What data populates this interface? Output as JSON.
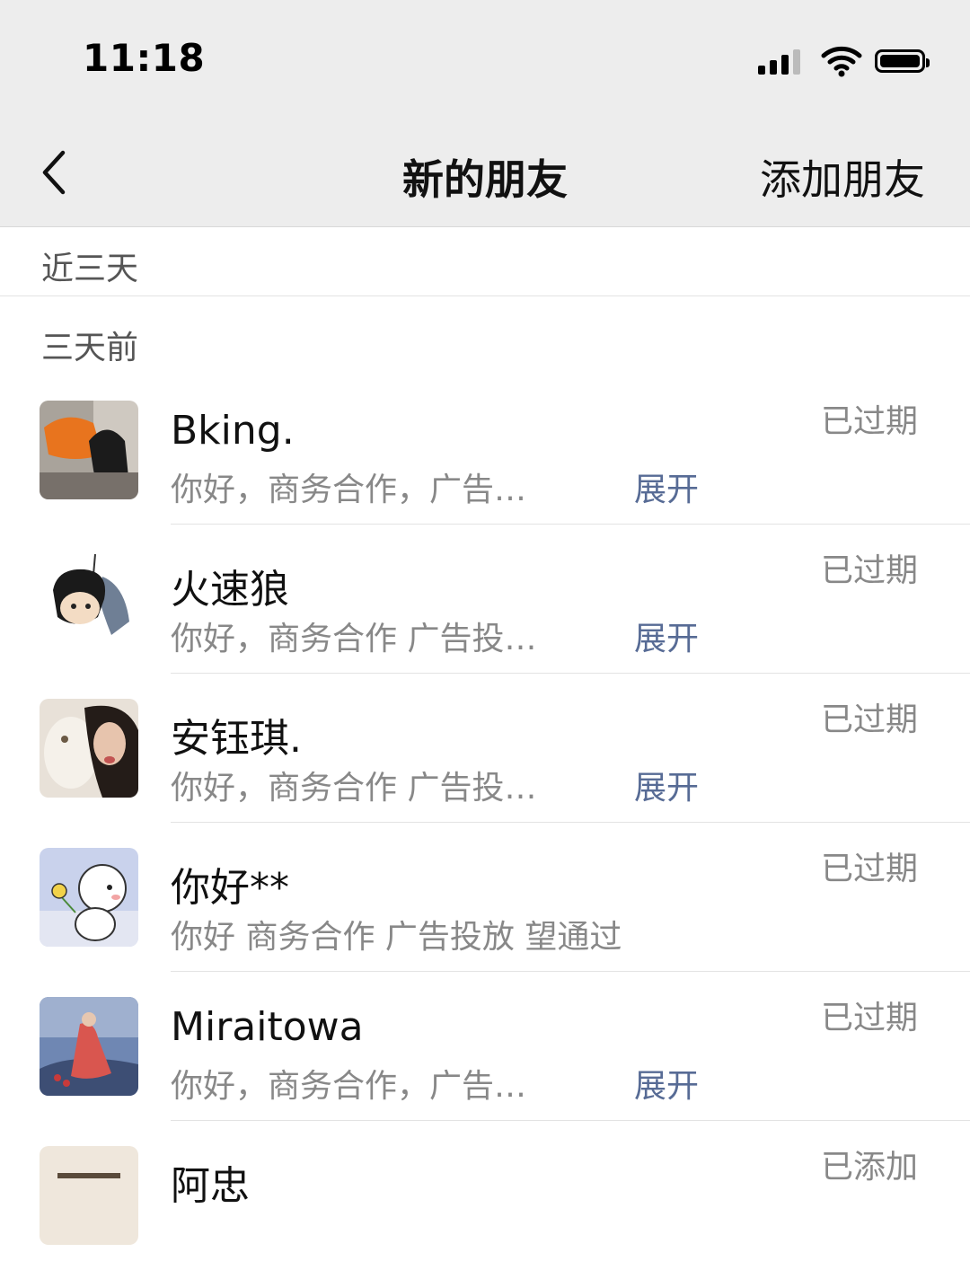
{
  "status_bar": {
    "time": "11:18"
  },
  "nav": {
    "title": "新的朋友",
    "add_friend": "添加朋友"
  },
  "sections": {
    "recent": "近三天",
    "earlier": "三天前"
  },
  "friends": [
    {
      "name": "Bking.",
      "message": "你好，商务合作，广告…",
      "action": "展开",
      "status": "已过期"
    },
    {
      "name": "火速狼",
      "message": "你好，商务合作 广告投…",
      "action": "展开",
      "status": "已过期"
    },
    {
      "name": "安钰琪.",
      "message": "你好，商务合作 广告投…",
      "action": "展开",
      "status": "已过期"
    },
    {
      "name": "你好**",
      "message": "你好 商务合作 广告投放 望通过",
      "action": "",
      "status": "已过期"
    },
    {
      "name": "Miraitowa",
      "message": "你好，商务合作，广告…",
      "action": "展开",
      "status": "已过期"
    },
    {
      "name": "阿忠",
      "message": "",
      "action": "",
      "status": "已添加"
    }
  ],
  "colors": {
    "nav_bg": "#ededed",
    "link": "#576b95",
    "muted": "#888888"
  },
  "icons": [
    "back-chevron-icon",
    "signal-icon",
    "wifi-icon",
    "battery-icon"
  ]
}
